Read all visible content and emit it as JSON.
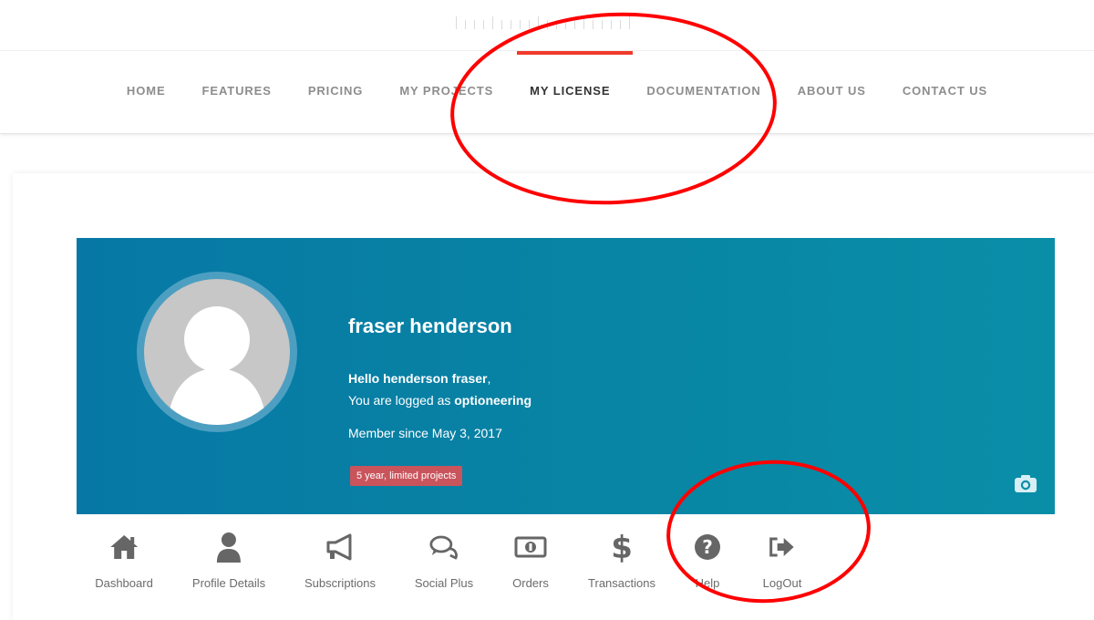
{
  "nav": {
    "items": [
      {
        "label": "HOME"
      },
      {
        "label": "FEATURES"
      },
      {
        "label": "PRICING"
      },
      {
        "label": "MY PROJECTS"
      },
      {
        "label": "MY LICENSE"
      },
      {
        "label": "DOCUMENTATION"
      },
      {
        "label": "ABOUT US"
      },
      {
        "label": "CONTACT US"
      }
    ],
    "active_index": 4,
    "active_color": "#f03a2c"
  },
  "profile": {
    "name": "fraser henderson",
    "greeting_name": "Hello henderson fraser",
    "greeting_suffix": ",",
    "logged_prefix": "You are logged as ",
    "username": "optioneering",
    "member_since": "Member since May 3, 2017",
    "license_badge": "5 year, limited projects",
    "banner_color": "#0778a5",
    "badge_color": "#c9545c"
  },
  "menu": {
    "items": [
      {
        "label": "Dashboard",
        "icon": "home-icon"
      },
      {
        "label": "Profile Details",
        "icon": "user-icon"
      },
      {
        "label": "Subscriptions",
        "icon": "megaphone-icon"
      },
      {
        "label": "Social Plus",
        "icon": "chat-icon"
      },
      {
        "label": "Orders",
        "icon": "money-icon"
      },
      {
        "label": "Transactions",
        "icon": "dollar-icon"
      },
      {
        "label": "Help",
        "icon": "question-icon"
      },
      {
        "label": "LogOut",
        "icon": "logout-icon"
      }
    ]
  },
  "annotations": {
    "color": "#ff0000"
  }
}
